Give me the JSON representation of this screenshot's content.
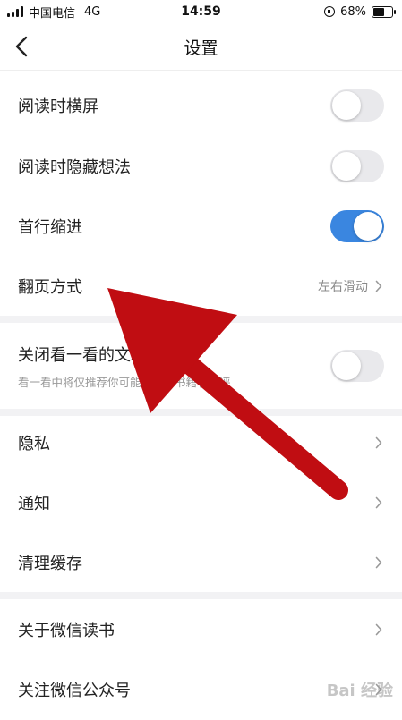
{
  "status_bar": {
    "carrier": "中国电信",
    "network": "4G",
    "time": "14:59",
    "battery_percent": "68%",
    "battery_level": 0.68
  },
  "nav": {
    "title": "设置",
    "back_icon": "chevron-left-icon"
  },
  "settings": {
    "landscape_reading": {
      "label": "阅读时横屏",
      "on": false
    },
    "hide_thoughts": {
      "label": "阅读时隐藏想法",
      "on": false
    },
    "first_line_indent": {
      "label": "首行缩进",
      "on": true
    },
    "page_turn": {
      "label": "翻页方式",
      "value": "左右滑动"
    },
    "close_look": {
      "label": "关闭看一看的文章推荐",
      "sub": "看一看中将仅推荐你可能喜欢的书籍和书评",
      "on": false
    },
    "privacy": {
      "label": "隐私"
    },
    "notifications": {
      "label": "通知"
    },
    "clear_cache": {
      "label": "清理缓存"
    },
    "about": {
      "label": "关于微信读书"
    },
    "follow_official": {
      "label": "关注微信公众号"
    }
  },
  "colors": {
    "toggle_on": "#3a86e0",
    "toggle_off": "#e9e9ec",
    "arrow": "#c00d12",
    "gap": "#f2f2f4"
  },
  "watermark": {
    "text": "Bai 经验"
  }
}
